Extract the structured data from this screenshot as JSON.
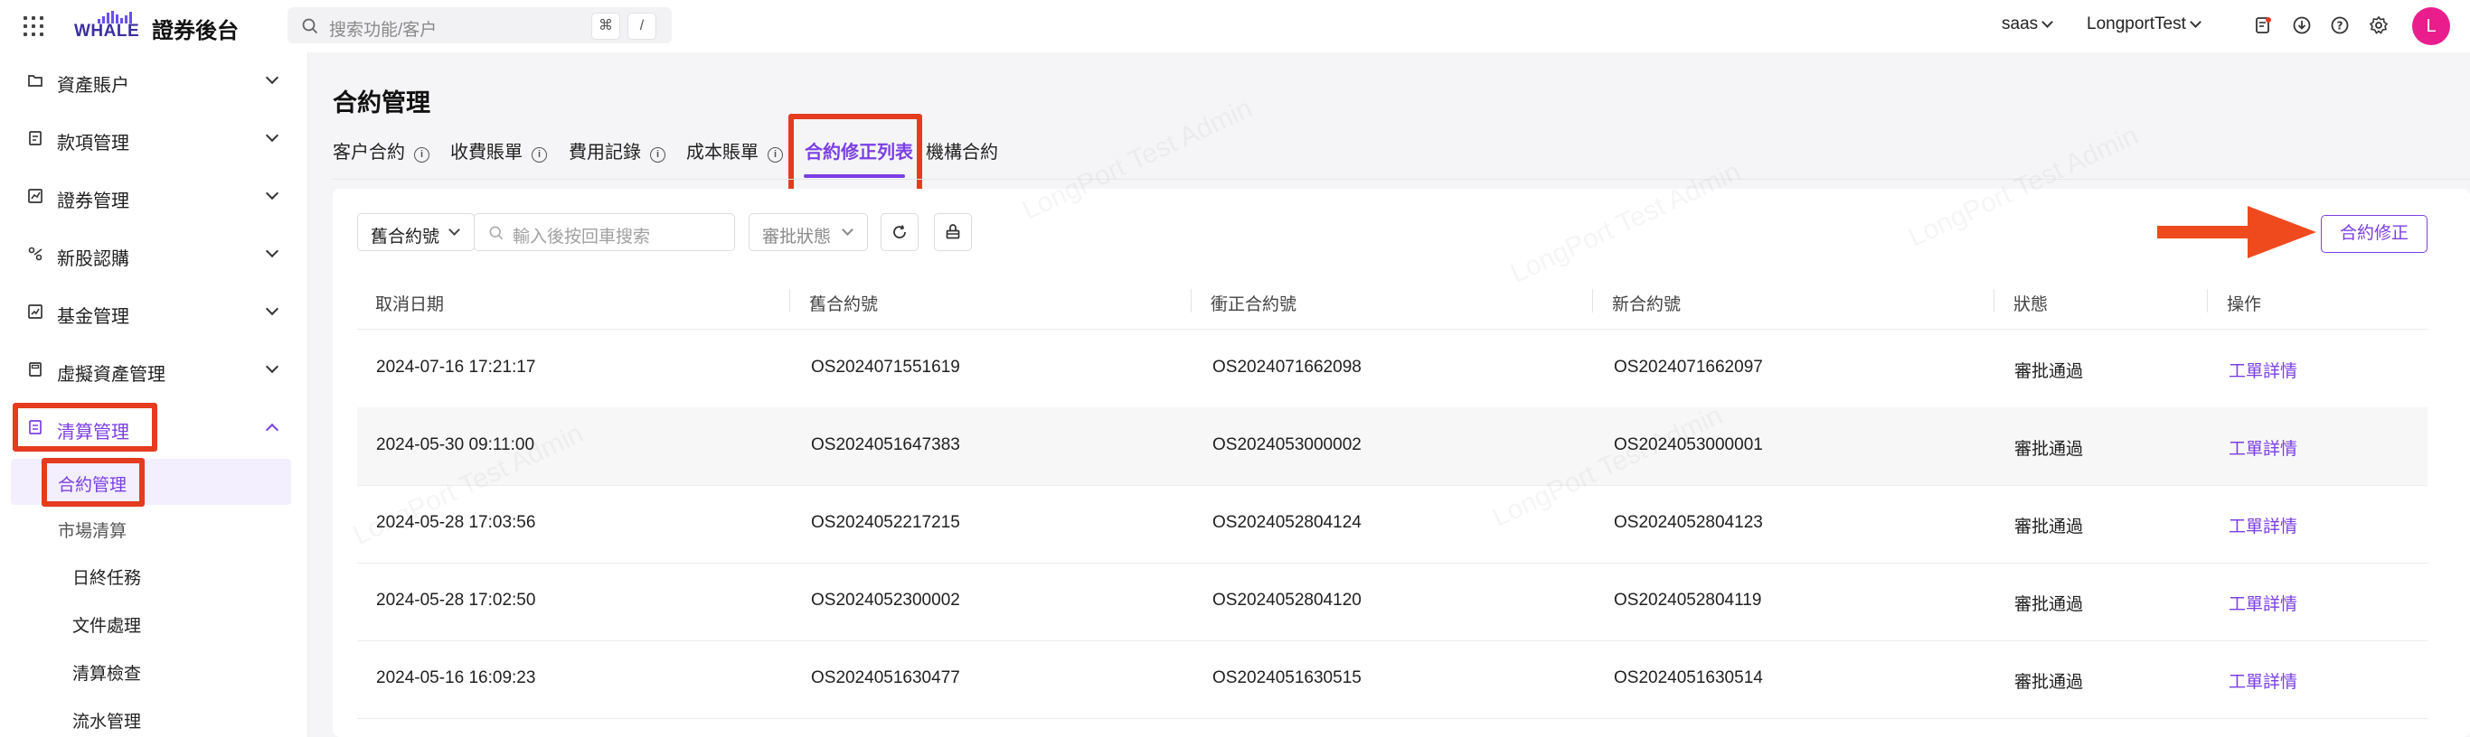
{
  "app": {
    "logo_text": "WHALE",
    "title": "證券後台"
  },
  "search": {
    "placeholder": "搜索功能/客户",
    "shortcut_cmd": "⌘",
    "shortcut_slash": "/"
  },
  "top_right": {
    "tenant": "saas",
    "org": "LongportTest",
    "avatar_letter": "L",
    "icons": [
      "notice-icon",
      "download-icon",
      "help-icon",
      "settings-icon"
    ]
  },
  "sidebar": {
    "items": [
      {
        "label": "資產賬户",
        "icon": "folder-icon",
        "expanded": false
      },
      {
        "label": "款項管理",
        "icon": "document-icon",
        "expanded": false
      },
      {
        "label": "證券管理",
        "icon": "chart-icon",
        "expanded": false
      },
      {
        "label": "新股認購",
        "icon": "ipo-icon",
        "expanded": false
      },
      {
        "label": "基金管理",
        "icon": "fund-icon",
        "expanded": false
      },
      {
        "label": "虛擬資產管理",
        "icon": "calculator-icon",
        "expanded": false
      },
      {
        "label": "清算管理",
        "icon": "clearing-icon",
        "expanded": true
      }
    ],
    "sub_items": [
      {
        "label": "合約管理",
        "active": true
      },
      {
        "label": "市場清算",
        "active": false
      },
      {
        "label": "日終任務",
        "active": false
      },
      {
        "label": "文件處理",
        "active": false
      },
      {
        "label": "清算檢查",
        "active": false
      },
      {
        "label": "流水管理",
        "active": false
      }
    ]
  },
  "main": {
    "title": "合約管理",
    "tabs": [
      {
        "label": "客户合約",
        "info": true
      },
      {
        "label": "收費賬單",
        "info": true
      },
      {
        "label": "費用記錄",
        "info": true
      },
      {
        "label": "成本賬單",
        "info": true
      },
      {
        "label": "合約修正列表",
        "info": false,
        "active": true
      },
      {
        "label": "機構合約",
        "info": false
      }
    ],
    "info_glyph": "i"
  },
  "filters": {
    "field_select": "舊合約號",
    "search_placeholder": "輸入後按回車搜索",
    "status_select": "審批狀態",
    "primary_button": "合約修正"
  },
  "table": {
    "columns": [
      "取消日期",
      "舊合約號",
      "衝正合約號",
      "新合約號",
      "狀態",
      "操作"
    ],
    "rows": [
      {
        "date": "2024-07-16 17:21:17",
        "old": "OS2024071551619",
        "reverse": "OS2024071662098",
        "new": "OS2024071662097",
        "status": "審批通過",
        "action": "工單詳情"
      },
      {
        "date": "2024-05-30 09:11:00",
        "old": "OS2024051647383",
        "reverse": "OS2024053000002",
        "new": "OS2024053000001",
        "status": "審批通過",
        "action": "工單詳情"
      },
      {
        "date": "2024-05-28 17:03:56",
        "old": "OS2024052217215",
        "reverse": "OS2024052804124",
        "new": "OS2024052804123",
        "status": "審批通過",
        "action": "工單詳情"
      },
      {
        "date": "2024-05-28 17:02:50",
        "old": "OS2024052300002",
        "reverse": "OS2024052804120",
        "new": "OS2024052804119",
        "status": "審批通過",
        "action": "工單詳情"
      },
      {
        "date": "2024-05-16 16:09:23",
        "old": "OS2024051630477",
        "reverse": "OS2024051630515",
        "new": "OS2024051630514",
        "status": "審批通過",
        "action": "工單詳情"
      }
    ]
  },
  "watermark": "LongPort Test Admin",
  "colors": {
    "accent": "#7b3fe4",
    "highlight": "#e53b1f",
    "avatar": "#e91e8c"
  }
}
